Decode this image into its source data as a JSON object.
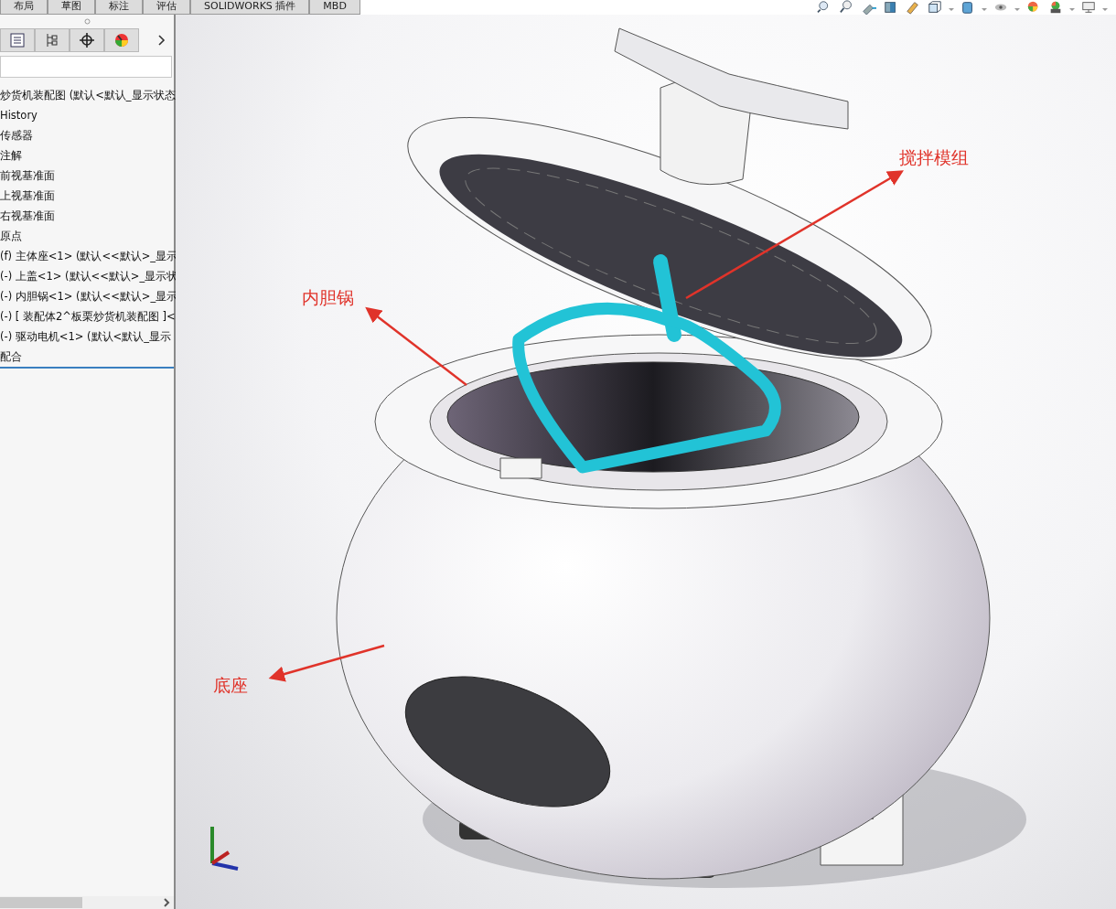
{
  "command_tabs": [
    {
      "label": "布局",
      "selected": false
    },
    {
      "label": "草图",
      "selected": false
    },
    {
      "label": "标注",
      "selected": false
    },
    {
      "label": "评估",
      "selected": false
    },
    {
      "label": "SOLIDWORKS 插件",
      "selected": false
    },
    {
      "label": "MBD",
      "selected": false
    }
  ],
  "feature_tree": {
    "items": [
      "炒货机装配图  (默认<默认_显示状态",
      "History",
      "传感器",
      "注解",
      "前视基准面",
      "上视基准面",
      "右视基准面",
      "原点",
      "(f) 主体座<1> (默认<<默认>_显示",
      "(-) 上盖<1> (默认<<默认>_显示状",
      "(-) 内胆锅<1> (默认<<默认>_显示",
      "(-) [ 装配体2^板栗炒货机装配图 ]<",
      "(-) 驱动电机<1> (默认<默认_显示",
      "配合"
    ]
  },
  "viewport": {
    "callouts": [
      {
        "label": "搅拌模组"
      },
      {
        "label": "内胆锅"
      },
      {
        "label": "底座"
      }
    ]
  }
}
